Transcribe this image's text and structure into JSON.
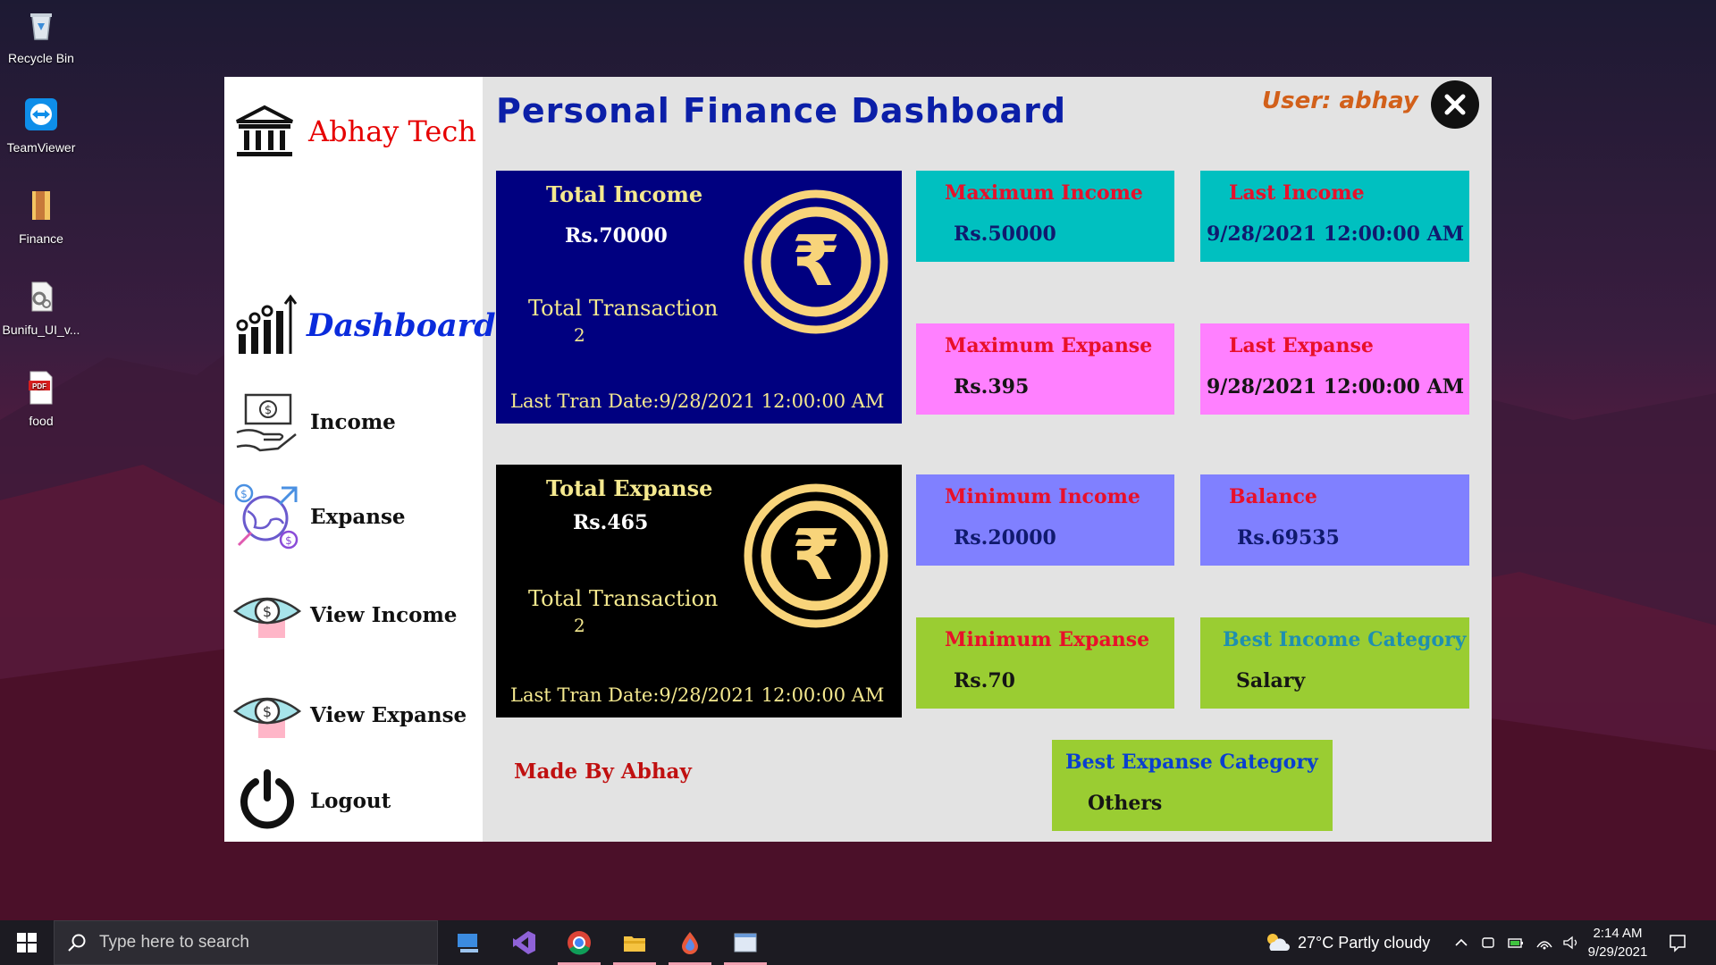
{
  "desktop": {
    "icons": [
      {
        "label": "Recycle Bin",
        "icon": "recycle-bin-icon"
      },
      {
        "label": "TeamViewer",
        "icon": "teamviewer-icon"
      },
      {
        "label": "Finance",
        "icon": "folder-icon"
      },
      {
        "label": "Bunifu_UI_v...",
        "icon": "settings-file-icon"
      },
      {
        "label": "food",
        "icon": "pdf-icon"
      }
    ]
  },
  "sidebar": {
    "brand": "Abhay Tech",
    "items": [
      {
        "label": "Dashboard",
        "icon": "bar-chart-icon"
      },
      {
        "label": "Income",
        "icon": "hand-money-icon"
      },
      {
        "label": "Expanse",
        "icon": "globe-money-icon"
      },
      {
        "label": "View Income",
        "icon": "eye-dollar-icon"
      },
      {
        "label": "View Expanse",
        "icon": "eye-dollar-icon"
      },
      {
        "label": "Logout",
        "icon": "power-icon"
      }
    ]
  },
  "header": {
    "title": "Personal Finance Dashboard",
    "user": "User: abhay"
  },
  "income_card": {
    "label": "Total Income",
    "value": "Rs.70000",
    "transaction_label": "Total Transaction",
    "transaction_count": "2",
    "last_date": "Last Tran Date:9/28/2021 12:00:00 AM"
  },
  "expanse_card": {
    "label": "Total Expanse",
    "value": "Rs.465",
    "transaction_label": "Total Transaction",
    "transaction_count": "2",
    "last_date": "Last Tran Date:9/28/2021 12:00:00 AM"
  },
  "stats": {
    "max_income": {
      "label": "Maximum Income",
      "value": "Rs.50000"
    },
    "last_income": {
      "label": "Last Income",
      "value": "9/28/2021 12:00:00 AM"
    },
    "max_expanse": {
      "label": "Maximum Expanse",
      "value": "Rs.395"
    },
    "last_expanse": {
      "label": "Last Expanse",
      "value": "9/28/2021 12:00:00 AM"
    },
    "min_income": {
      "label": "Minimum Income",
      "value": "Rs.20000"
    },
    "balance": {
      "label": "Balance",
      "value": "Rs.69535"
    },
    "min_expanse": {
      "label": "Minimum Expanse",
      "value": "Rs.70"
    },
    "best_income_category": {
      "label": "Best Income Category",
      "value": "Salary"
    },
    "best_expanse_category": {
      "label": "Best Expanse Category",
      "value": "Others"
    }
  },
  "footer": {
    "made_by": "Made By Abhay"
  },
  "colors": {
    "income_card_bg": "#000080",
    "expanse_card_bg": "#000000",
    "cyan_card": "#00c0c0",
    "pink_card": "#ff80ff",
    "periwinkle_card": "#8080ff",
    "green_card": "#9acd32",
    "coin": "#f8d47a"
  },
  "taskbar": {
    "search_placeholder": "Type here to search",
    "weather": "27°C  Partly cloudy",
    "time": "2:14 AM",
    "date": "9/29/2021"
  }
}
